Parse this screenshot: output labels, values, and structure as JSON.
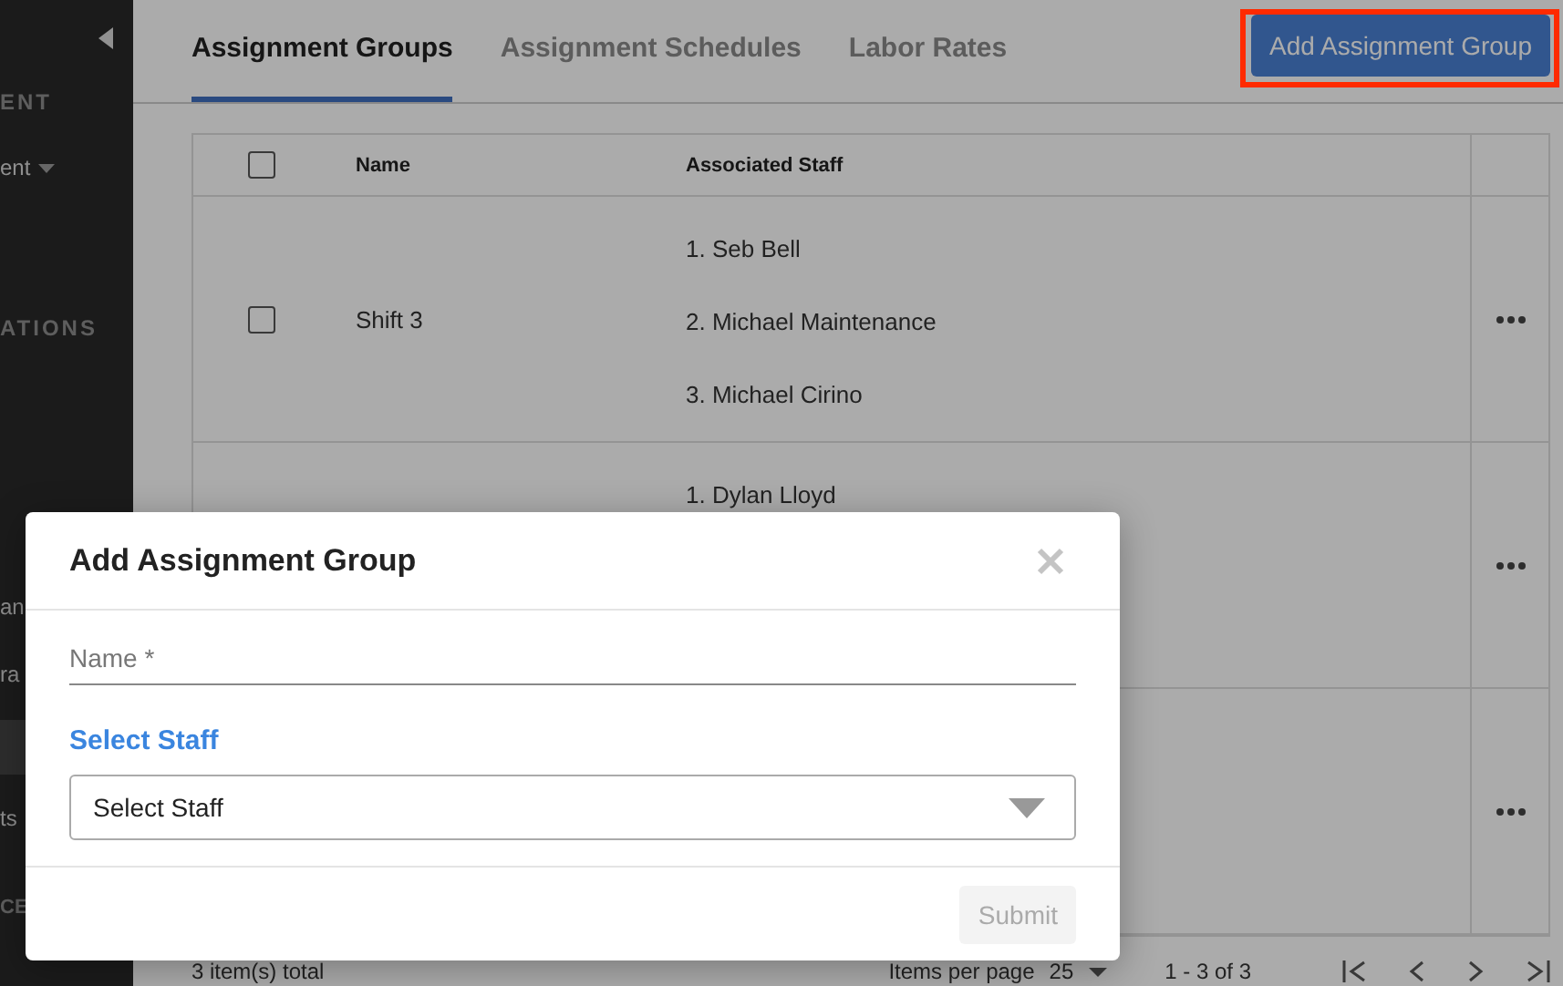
{
  "sidebar": {
    "items": [
      {
        "kind": "section",
        "label": "ENT"
      },
      {
        "kind": "dropdown",
        "label": "ent"
      },
      {
        "kind": "section",
        "label": "ATIONS"
      },
      {
        "kind": "link",
        "label": "an",
        "selected": false
      },
      {
        "kind": "link",
        "label": "ra",
        "selected": false
      },
      {
        "kind": "link",
        "selected": true
      },
      {
        "kind": "link",
        "label": "ts",
        "selected": false
      },
      {
        "kind": "section",
        "label": "CE"
      }
    ]
  },
  "tabs": [
    {
      "label": "Assignment Groups",
      "selected": true
    },
    {
      "label": "Assignment Schedules",
      "selected": false
    },
    {
      "label": "Labor Rates",
      "selected": false
    }
  ],
  "add_button": {
    "label": "Add Assignment Group"
  },
  "table": {
    "header_checkbox": {
      "checked": false
    },
    "columns": [
      "Name",
      "Associated Staff"
    ],
    "rows": [
      {
        "checkbox": {
          "checked": false
        },
        "name": "Shift 3",
        "staff": [
          "1. Seb Bell",
          "2. Michael Maintenance",
          "3. Michael Cirino"
        ]
      },
      {
        "staff": [
          "1. Dylan Lloyd"
        ]
      },
      {}
    ]
  },
  "footer": {
    "total": "3 item(s) total",
    "per_page_label": "Items per page",
    "per_page_value": "25",
    "range": "1 - 3 of 3"
  },
  "modal": {
    "title": "Add Assignment Group",
    "name_field": {
      "placeholder": "Name *"
    },
    "section_label": "Select Staff",
    "select": {
      "value": "Select Staff"
    },
    "submit": {
      "label": "Submit",
      "disabled": true
    }
  }
}
